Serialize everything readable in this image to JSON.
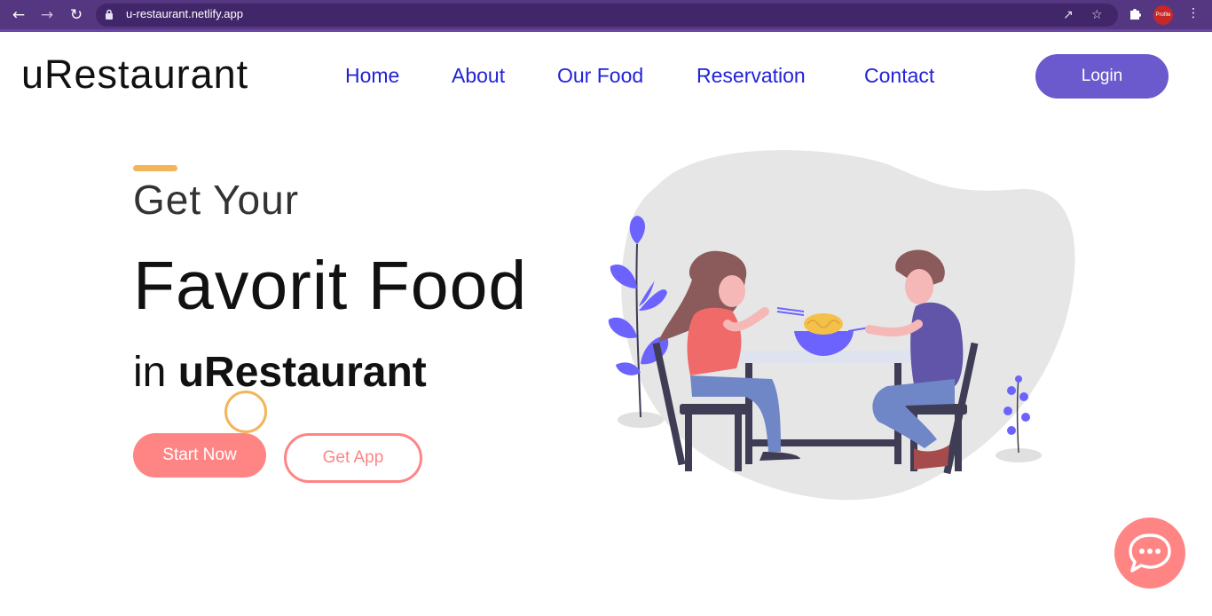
{
  "browser": {
    "url": "u-restaurant.netlify.app",
    "profile_badge": "Profile"
  },
  "site": {
    "brand": "uRestaurant",
    "nav": [
      "Home",
      "About",
      "Our Food",
      "Reservation",
      "Contact"
    ],
    "login_label": "Login"
  },
  "hero": {
    "line1": "Get Your",
    "line2": "Favorit Food",
    "line3_prefix": "in",
    "line3_brand": "uRestaurant",
    "start_label": "Start Now",
    "app_label": "Get App"
  },
  "colors": {
    "chrome": "#553680",
    "accent": "#6a5acd",
    "coral": "#ff8585",
    "gold": "#f4b459",
    "nav_link": "#2222d9"
  },
  "icons": [
    "back-icon",
    "forward-icon",
    "reload-icon",
    "lock-icon",
    "share-icon",
    "star-icon",
    "puzzle-icon",
    "kebab-menu-icon",
    "chat-icon"
  ]
}
